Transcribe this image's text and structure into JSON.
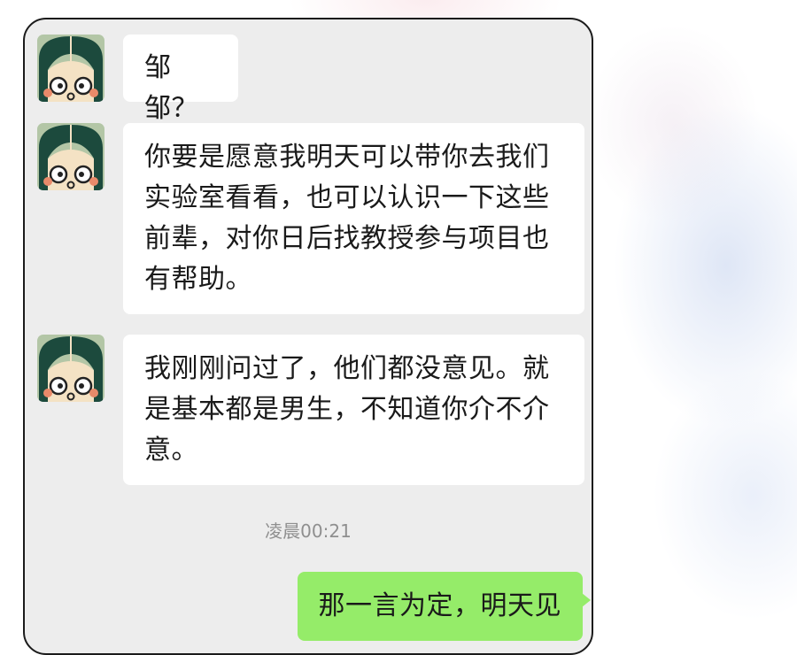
{
  "chat": {
    "messages": [
      {
        "sender": "other",
        "avatar_icon": "cartoon-girl-avatar",
        "text": "邹邹？"
      },
      {
        "sender": "other",
        "avatar_icon": "cartoon-girl-avatar",
        "text": "你要是愿意我明天可以带你去我们实验室看看，也可以认识一下这些前辈，对你日后找教授参与项目也有帮助。"
      },
      {
        "sender": "other",
        "avatar_icon": "cartoon-girl-avatar",
        "text": "我刚刚问过了，他们都没意见。就是基本都是男生，不知道你介不介意。"
      },
      {
        "sender": "self",
        "text": "那一言为定，明天见"
      }
    ],
    "timestamp": "凌晨00:21"
  },
  "colors": {
    "chat_background": "#ededed",
    "incoming_bubble": "#ffffff",
    "outgoing_bubble": "#95ec69",
    "timestamp_text": "#8f8f8f",
    "frame_border": "#1b1b1b"
  }
}
